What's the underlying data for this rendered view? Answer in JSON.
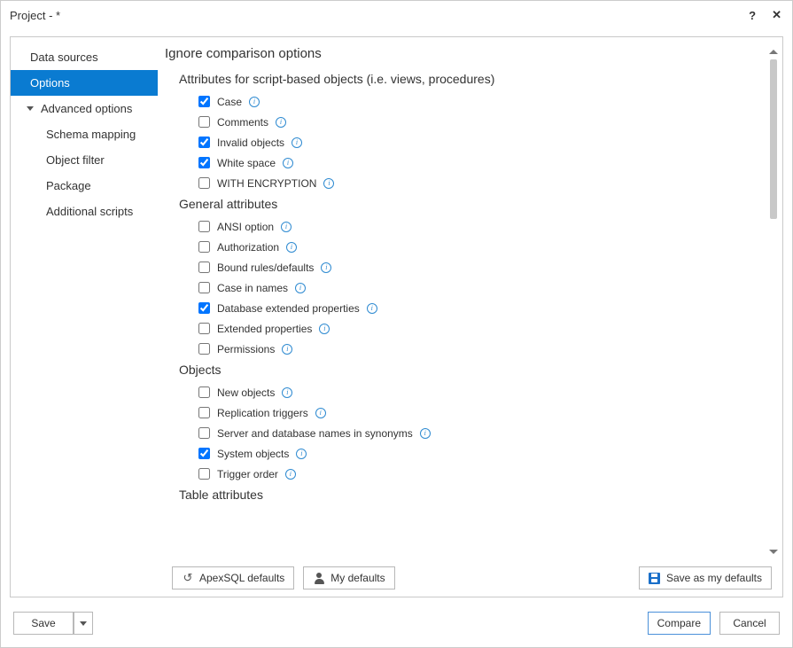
{
  "title": "Project  - *",
  "sidebar": {
    "items": [
      {
        "label": "Data sources",
        "selected": false,
        "indented": false,
        "sub": false,
        "expand": false
      },
      {
        "label": "Options",
        "selected": true,
        "indented": false,
        "sub": false,
        "expand": false
      },
      {
        "label": "Advanced options",
        "selected": false,
        "indented": true,
        "sub": false,
        "expand": true
      },
      {
        "label": "Schema mapping",
        "selected": false,
        "indented": false,
        "sub": true,
        "expand": false
      },
      {
        "label": "Object filter",
        "selected": false,
        "indented": false,
        "sub": true,
        "expand": false
      },
      {
        "label": "Package",
        "selected": false,
        "indented": false,
        "sub": true,
        "expand": false
      },
      {
        "label": "Additional scripts",
        "selected": false,
        "indented": false,
        "sub": true,
        "expand": false
      }
    ]
  },
  "page_title": "Ignore comparison options",
  "sections": [
    {
      "title": "Attributes for script-based objects (i.e. views, procedures)",
      "items": [
        {
          "label": "Case",
          "checked": true
        },
        {
          "label": "Comments",
          "checked": false
        },
        {
          "label": "Invalid objects",
          "checked": true
        },
        {
          "label": "White space",
          "checked": true
        },
        {
          "label": "WITH ENCRYPTION",
          "checked": false
        }
      ]
    },
    {
      "title": "General attributes",
      "items": [
        {
          "label": "ANSI option",
          "checked": false
        },
        {
          "label": "Authorization",
          "checked": false
        },
        {
          "label": "Bound rules/defaults",
          "checked": false
        },
        {
          "label": "Case in names",
          "checked": false
        },
        {
          "label": "Database extended properties",
          "checked": true
        },
        {
          "label": "Extended properties",
          "checked": false
        },
        {
          "label": "Permissions",
          "checked": false
        }
      ]
    },
    {
      "title": "Objects",
      "items": [
        {
          "label": "New objects",
          "checked": false
        },
        {
          "label": "Replication triggers",
          "checked": false
        },
        {
          "label": "Server and database names in synonyms",
          "checked": false
        },
        {
          "label": "System objects",
          "checked": true
        },
        {
          "label": "Trigger order",
          "checked": false
        }
      ]
    },
    {
      "title": "Table attributes",
      "items": []
    }
  ],
  "buttons": {
    "apex_defaults": "ApexSQL defaults",
    "my_defaults": "My defaults",
    "save_defaults": "Save as my defaults",
    "save": "Save",
    "compare": "Compare",
    "cancel": "Cancel"
  }
}
